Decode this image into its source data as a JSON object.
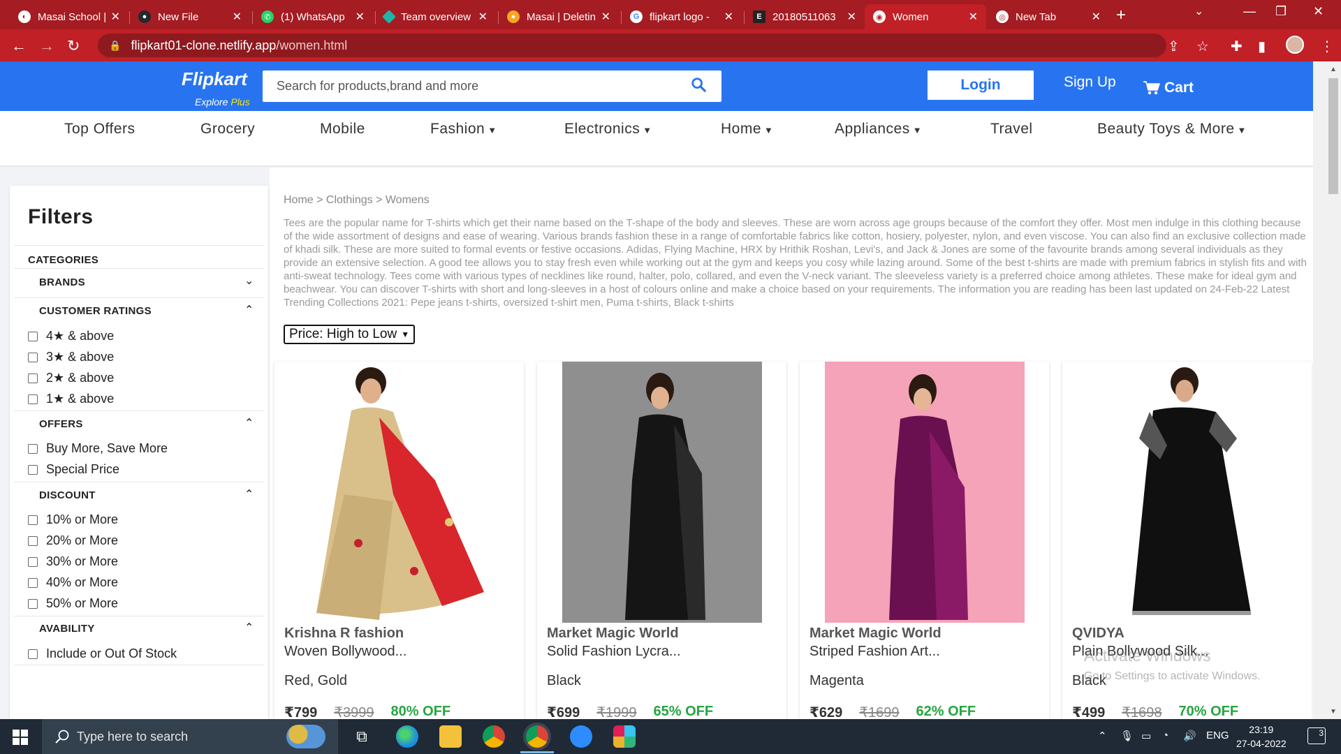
{
  "browser": {
    "tabs": [
      {
        "title": "Masai School |",
        "icon_color": "#ffffff",
        "icon": "masai-icon"
      },
      {
        "title": "New File",
        "icon_color": "#24292e",
        "icon": "github-icon"
      },
      {
        "title": "(1) WhatsApp",
        "icon_color": "#25d366",
        "icon": "whatsapp-icon"
      },
      {
        "title": "Team overview",
        "icon_color": "#1fb5a6",
        "icon": "diamond-icon"
      },
      {
        "title": "Masai | Deletin",
        "icon_color": "#f5a623",
        "icon": "masai-icon"
      },
      {
        "title": "flipkart logo -",
        "icon_color": "#4285f4",
        "icon": "google-icon"
      },
      {
        "title": "20180511063",
        "icon_color": "#222222",
        "icon": "e-icon"
      },
      {
        "title": "Women",
        "icon_color": "#ffffff",
        "icon": "globe-icon",
        "active": true
      },
      {
        "title": "New Tab",
        "icon_color": "#ffffff",
        "icon": "chrome-icon"
      }
    ],
    "url_domain": "flipkart01-clone.netlify.app",
    "url_path": "/women.html"
  },
  "header": {
    "logo": "Flipkart",
    "explore": "Explore",
    "plus": "Plus",
    "search_placeholder": "Search for products,brand and more",
    "login": "Login",
    "signup": "Sign Up",
    "cart": "Cart"
  },
  "nav": {
    "items": [
      "Top Offers",
      "Grocery",
      "Mobile",
      "Fashion",
      "Electronics",
      "Home",
      "Appliances",
      "Travel",
      "Beauty Toys & More"
    ]
  },
  "filters": {
    "title": "Filters",
    "categories": "CATEGORIES",
    "brands": "BRANDS",
    "ratings_title": "CUSTOMER RATINGS",
    "ratings": [
      "4★ & above",
      "3★ & above",
      "2★ & above",
      "1★ & above"
    ],
    "offers_title": "OFFERS",
    "offers": [
      "Buy More, Save More",
      "Special Price"
    ],
    "discount_title": "DISCOUNT",
    "discounts": [
      "10% or More",
      "20% or More",
      "30% or More",
      "40% or More",
      "50% or More"
    ],
    "availability_title": "AVABILITY",
    "availability": [
      "Include or Out Of Stock"
    ]
  },
  "main": {
    "breadcrumb": "Home > Clothings > Womens",
    "description": "Tees are the popular name for T-shirts which get their name based on the T-shape of the body and sleeves. These are worn across age groups because of the comfort they offer. Most men indulge in this clothing because of the wide assortment of designs and ease of wearing. Various brands fashion these in a range of comfortable fabrics like cotton, hosiery, polyester, nylon, and even viscose. You can also find an exclusive collection made of khadi silk. These are more suited to formal events or festive occasions. Adidas, Flying Machine, HRX by Hrithik Roshan, Levi's, and Jack & Jones are some of the favourite brands among several individuals as they provide an extensive selection. A good tee allows you to stay fresh even while working out at the gym and keeps you cosy while lazing around. Some of the best t-shirts are made with premium fabrics in stylish fits and with anti-sweat technology. Tees come with various types of necklines like round, halter, polo, collared, and even the V-neck variant. The sleeveless variety is a preferred choice among athletes. These make for ideal gym and beachwear. You can discover T-shirts with short and long-sleeves in a host of colours online and make a choice based on your requirements. The information you are reading has been last updated on 24-Feb-22 Latest Trending Collections 2021: Pepe jeans t-shirts, oversized t-shirt men, Puma t-shirts, Black t-shirts",
    "sort_label": "Price: High to Low"
  },
  "products": [
    {
      "brand": "Krishna R fashion",
      "name": "Woven Bollywood...",
      "color": "Red, Gold",
      "price": "₹799",
      "mrp": "₹3999",
      "off": "80% OFF",
      "bg": "#ffffff"
    },
    {
      "brand": "Market Magic World",
      "name": "Solid Fashion Lycra...",
      "color": "Black",
      "price": "₹699",
      "mrp": "₹1999",
      "off": "65% OFF",
      "bg": "#8f8f8f"
    },
    {
      "brand": "Market Magic World",
      "name": "Striped Fashion Art...",
      "color": "Magenta",
      "price": "₹629",
      "mrp": "₹1699",
      "off": "62% OFF",
      "bg": "#f4a3b8"
    },
    {
      "brand": "QVIDYA",
      "name": "Plain Bollywood Silk...",
      "color": "Black",
      "price": "₹499",
      "mrp": "₹1698",
      "off": "70% OFF",
      "bg": "#ffffff"
    }
  ],
  "watermark": {
    "line1": "Activate Windows",
    "line2": "Go to Settings to activate Windows."
  },
  "taskbar": {
    "search_placeholder": "Type here to search",
    "lang": "ENG",
    "time": "23:19",
    "date": "27-04-2022",
    "notifications": "3"
  },
  "colors": {
    "flipkart_blue": "#2874f0",
    "browser_red": "#c02026",
    "discount_green": "#26a541"
  }
}
